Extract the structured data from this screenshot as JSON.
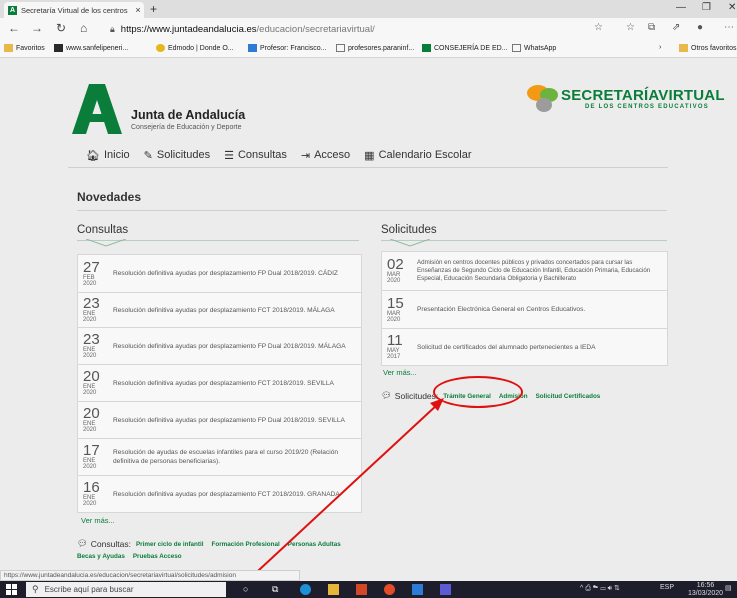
{
  "browser": {
    "tab_title": "Secretaría Virtual de los centros",
    "tab_close": "×",
    "new_tab": "+",
    "url_host": "https://www.juntadeandalucia.es",
    "url_path": "/educacion/secretariavirtual/",
    "bookmarks": [
      "Favoritos",
      "www.sanfelipeneri...",
      "Edmodo | Donde O...",
      "Profesor: Francisco...",
      "profesores.paraninf...",
      "CONSEJERÍA DE ED...",
      "WhatsApp"
    ],
    "other_favorites": "Otros favoritos"
  },
  "header": {
    "title": "Junta de Andalucía",
    "subtitle": "Consejería de Educación y Deporte",
    "sv_title_1": "SECRETARÍA",
    "sv_title_2": "VIRTUAL",
    "sv_subtitle": "DE LOS CENTROS EDUCATIVOS"
  },
  "menu": [
    "Inicio",
    "Solicitudes",
    "Consultas",
    "Acceso",
    "Calendario Escolar"
  ],
  "novedades": "Novedades",
  "consultas": {
    "title": "Consultas",
    "items": [
      {
        "day": "27",
        "month": "FEB",
        "year": "2020",
        "text": "Resolución definitiva ayudas por desplazamiento FP Dual 2018/2019. CÁDIZ"
      },
      {
        "day": "23",
        "month": "ENE",
        "year": "2020",
        "text": "Resolución definitiva ayudas por desplazamiento FCT 2018/2019. MÁLAGA"
      },
      {
        "day": "23",
        "month": "ENE",
        "year": "2020",
        "text": "Resolución definitiva ayudas por desplazamiento FP Dual 2018/2019. MÁLAGA"
      },
      {
        "day": "20",
        "month": "ENE",
        "year": "2020",
        "text": "Resolución definitiva ayudas por desplazamiento FCT 2018/2019. SEVILLA"
      },
      {
        "day": "20",
        "month": "ENE",
        "year": "2020",
        "text": "Resolución definitiva ayudas por desplazamiento FP Dual 2018/2019. SEVILLA"
      },
      {
        "day": "17",
        "month": "ENE",
        "year": "2020",
        "text": "Resolución de ayudas de escuelas infantiles para el curso 2019/20 (Relación definitiva de personas beneficiarias)."
      },
      {
        "day": "16",
        "month": "ENE",
        "year": "2020",
        "text": "Resolución definitiva ayudas por desplazamiento FCT 2018/2019. GRANADA"
      }
    ],
    "ver_mas": "Ver más...",
    "links_label": "Consultas:",
    "links": [
      "Primer ciclo de infantil",
      "Formación Profesional",
      "Personas Adultas"
    ],
    "links_row2": [
      "Becas y Ayudas",
      "Pruebas Acceso"
    ]
  },
  "solicitudes": {
    "title": "Solicitudes",
    "items": [
      {
        "day": "02",
        "month": "MAR",
        "year": "2020",
        "text": "Admisión en centros docentes públicos y privados concertados para cursar las Enseñanzas de Segundo Ciclo de Educación Infantil, Educación Primaria, Educación Especial, Educación Secundaria Obligatoria y Bachillerato"
      },
      {
        "day": "15",
        "month": "MAR",
        "year": "2020",
        "text": "Presentación Electrónica General en Centros Educativos."
      },
      {
        "day": "11",
        "month": "MAY",
        "year": "2017",
        "text": "Solicitud de certificados del alumnado pertenecientes a IEDA"
      }
    ],
    "ver_mas": "Ver más...",
    "links_label": "Solicitudes:",
    "links": [
      "Trámite General",
      "Admisión",
      "Solicitud Certificados"
    ]
  },
  "status_url": "https://www.juntadeandalucia.es/educacion/secretariavirtual/solicitudes/admision",
  "taskbar": {
    "search": "Escribe aquí para buscar",
    "lang": "ESP",
    "time": "16:56",
    "date": "13/03/2020"
  },
  "colors": {
    "brand_green": "#0a7d3a",
    "annotation_red": "#e01010"
  }
}
